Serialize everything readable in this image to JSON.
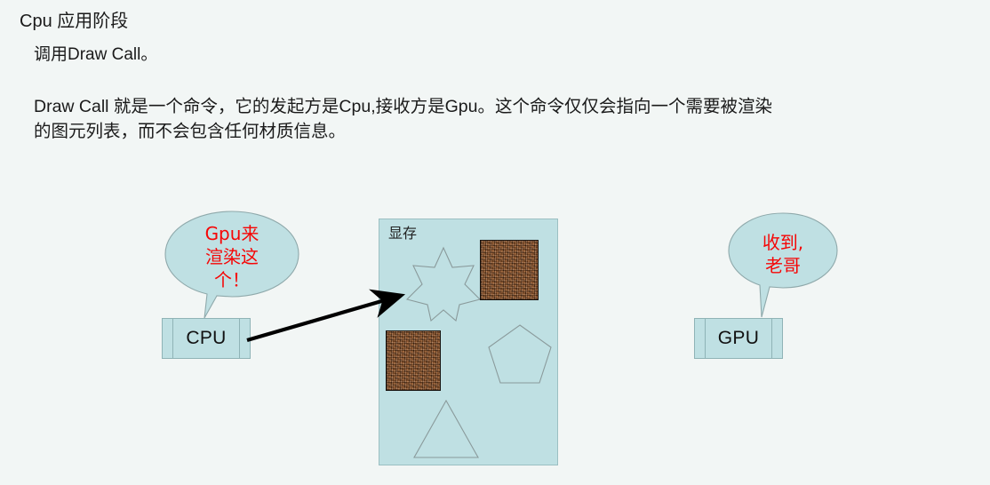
{
  "document": {
    "title": "Cpu 应用阶段",
    "paragraph_1": "调用Draw Call。",
    "paragraph_2_line_1": "Draw Call 就是一个命令，它的发起方是Cpu,接收方是Gpu。这个命令仅仅会指向一个需要被渲染",
    "paragraph_2_line_2": "的图元列表，而不会包含任何材质信息。"
  },
  "diagram": {
    "vram": {
      "label": "显存",
      "shapes": [
        {
          "name": "star-shape",
          "sides": 7
        },
        {
          "name": "texture-square-top"
        },
        {
          "name": "texture-square-bottom"
        },
        {
          "name": "pentagon-shape",
          "sides": 5
        },
        {
          "name": "triangle-shape",
          "sides": 3
        }
      ]
    },
    "cpu": {
      "label": "CPU",
      "bubble_line_1": "Gpu来",
      "bubble_line_2": "渲染这",
      "bubble_line_3": "个！"
    },
    "gpu": {
      "label": "GPU",
      "bubble_line_1": "收到,",
      "bubble_line_2": "老哥"
    },
    "arrow": {
      "name": "draw-call-arrow"
    }
  },
  "colors": {
    "page_background": "#f2f6f5",
    "panel_fill": "#bfe0e3",
    "panel_stroke": "#8fb3b6",
    "shape_outline": "#8a9a9b",
    "bubble_text": "#f60505",
    "texture_brown": "#8f5326",
    "arrow": "#000000",
    "body_text": "#1a1a1a"
  }
}
